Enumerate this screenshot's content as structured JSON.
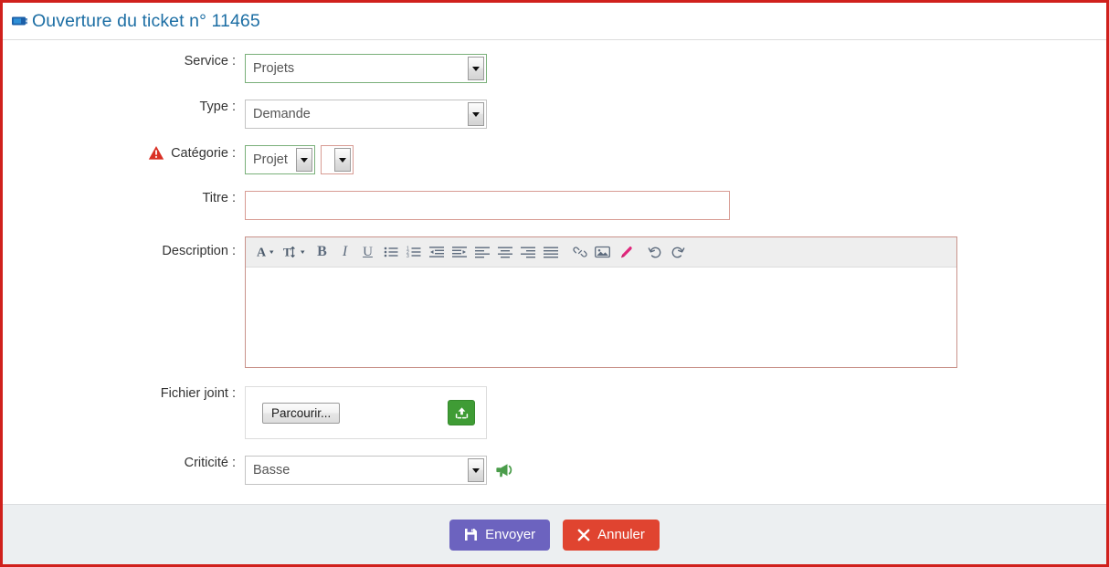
{
  "header": {
    "icon": "ticket-icon",
    "title": "Ouverture du ticket n° 11465",
    "title_color": "#1c6ea4"
  },
  "form": {
    "fields": {
      "service": {
        "label": "Service :",
        "value": "Projets",
        "border_color": "#7ab07a"
      },
      "type": {
        "label": "Type :",
        "value": "Demande",
        "border_color": "#c3c3c3"
      },
      "categorie": {
        "label": "Catégorie :",
        "warning_icon": "warning-triangle-icon",
        "value": "Projet",
        "border_color": "#7ab07a",
        "sub_value": "",
        "sub_border_color": "#d79b93"
      },
      "titre": {
        "label": "Titre :",
        "value": "",
        "placeholder": "",
        "border_color": "#d79b93"
      },
      "description": {
        "label": "Description :",
        "value": "",
        "border_color": "#c9938b",
        "toolbar": [
          {
            "name": "font-color-icon",
            "glyph": "A",
            "has_chevron": true
          },
          {
            "name": "font-size-icon",
            "glyph": "T↕",
            "has_chevron": true
          },
          {
            "name": "bold-icon",
            "glyph": "B",
            "has_chevron": false
          },
          {
            "name": "italic-icon",
            "glyph": "I",
            "has_chevron": false
          },
          {
            "name": "underline-icon",
            "glyph": "U",
            "has_chevron": false
          },
          {
            "name": "bullet-list-icon",
            "glyph": "",
            "has_chevron": false
          },
          {
            "name": "numbered-list-icon",
            "glyph": "",
            "has_chevron": false
          },
          {
            "name": "outdent-icon",
            "glyph": "",
            "has_chevron": false
          },
          {
            "name": "indent-icon",
            "glyph": "",
            "has_chevron": false
          },
          {
            "name": "align-left-icon",
            "glyph": "",
            "has_chevron": false
          },
          {
            "name": "align-center-icon",
            "glyph": "",
            "has_chevron": false
          },
          {
            "name": "align-right-icon",
            "glyph": "",
            "has_chevron": false
          },
          {
            "name": "align-justify-icon",
            "glyph": "",
            "has_chevron": false
          },
          {
            "name": "link-icon",
            "glyph": "",
            "has_chevron": false
          },
          {
            "name": "image-icon",
            "glyph": "",
            "has_chevron": false
          },
          {
            "name": "highlighter-icon",
            "glyph": "",
            "has_chevron": false
          },
          {
            "name": "undo-icon",
            "glyph": "",
            "has_chevron": false
          },
          {
            "name": "redo-icon",
            "glyph": "",
            "has_chevron": false
          }
        ]
      },
      "fichier_joint": {
        "label": "Fichier joint :",
        "browse_label": "Parcourir...",
        "upload_icon": "upload-icon",
        "upload_color": "#3f9c35"
      },
      "criticite": {
        "label": "Criticité :",
        "value": "Basse",
        "border_color": "#c3c3c3",
        "megaphone_icon": "megaphone-icon",
        "megaphone_color": "#4a9c4a"
      }
    }
  },
  "footer": {
    "submit": {
      "label": "Envoyer",
      "icon": "save-icon",
      "color": "#6c63bf"
    },
    "cancel": {
      "label": "Annuler",
      "icon": "close-x-icon",
      "color": "#e04430"
    }
  }
}
